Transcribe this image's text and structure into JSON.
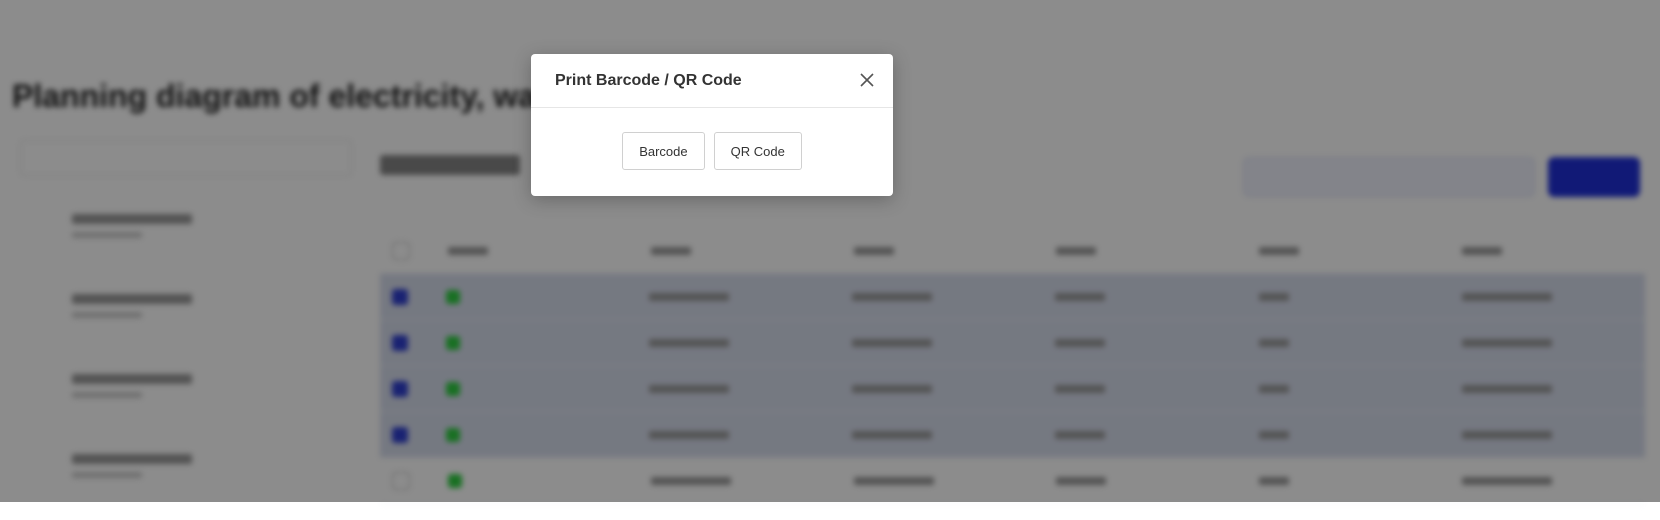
{
  "modal": {
    "title": "Print Barcode / QR Code",
    "buttons": {
      "barcode": "Barcode",
      "qrcode": "QR Code"
    }
  },
  "colors": {
    "primary": "#1f2fd8",
    "selected_row": "#d6dcec",
    "status_green": "#2ecc40",
    "overlay": "rgba(0,0,0,0.45)"
  },
  "background": {
    "title": "Planning diagram of electricity, water a..."
  },
  "table_rows_selected": [
    true,
    true,
    true,
    true,
    false
  ]
}
